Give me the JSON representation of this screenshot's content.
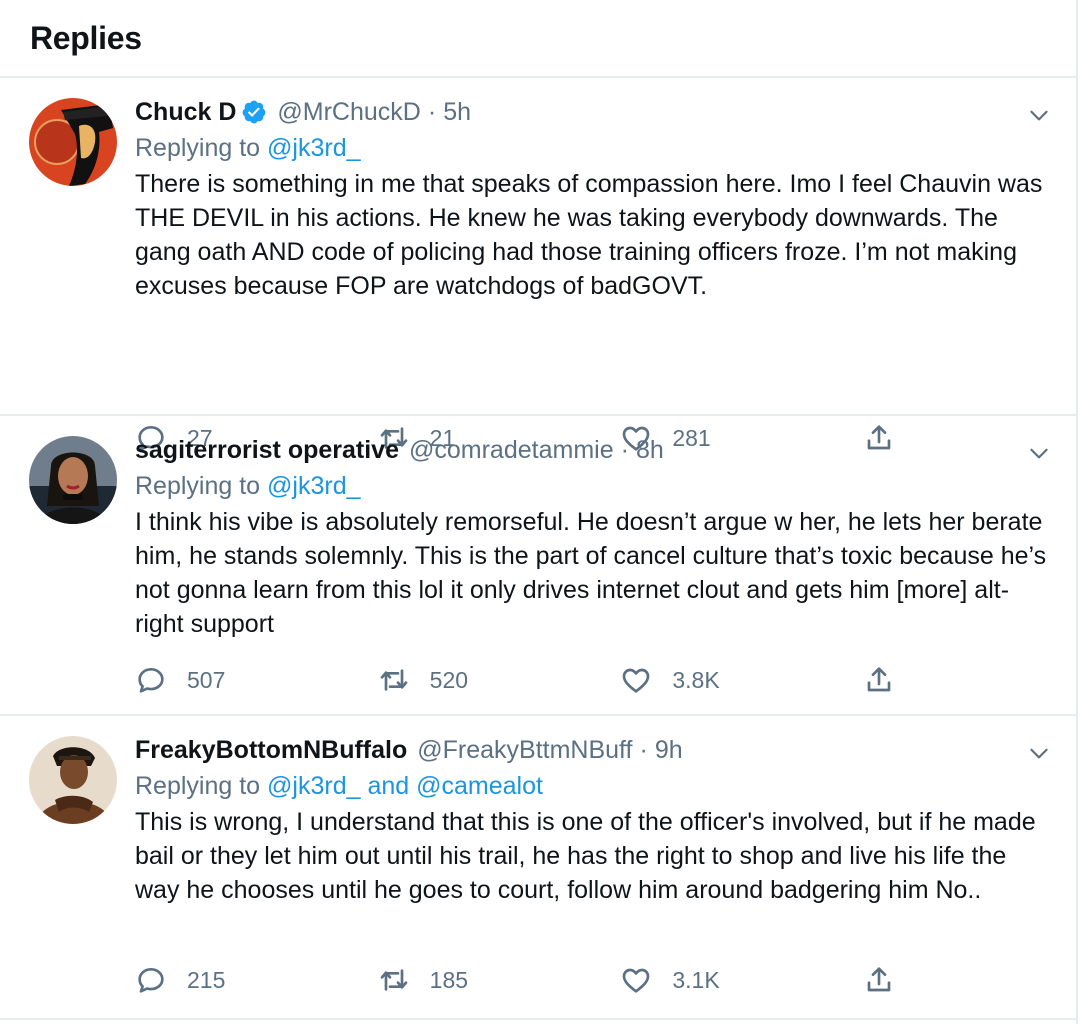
{
  "header": {
    "title": "Replies"
  },
  "replies": [
    {
      "name": "Chuck D",
      "verified": true,
      "handle": "@MrChuckD",
      "time": "5h",
      "replying_label": "Replying to",
      "mentions": "@jk3rd_",
      "text": "There is something in me that speaks of compassion here. Imo I feel Chauvin was THE DEVIL in his actions. He knew he was taking everybody downwards. The gang oath AND code of policing had those training officers froze. I’m not making excuses because FOP are watchdogs of badGOVT.",
      "replies_count": "27",
      "retweets_count": "21",
      "likes_count": "281"
    },
    {
      "name": "sagiterrorist operative",
      "verified": false,
      "handle": "@comradetammie",
      "time": "8h",
      "replying_label": "Replying to",
      "mentions": "@jk3rd_",
      "text": "I think his vibe is absolutely remorseful. He doesn’t argue w her, he lets her berate him, he stands solemnly. This is the part of cancel culture that’s toxic because he’s not gonna learn from this lol it only drives internet clout and gets him [more] alt-right support",
      "replies_count": "507",
      "retweets_count": "520",
      "likes_count": "3.8K"
    },
    {
      "name": "FreakyBottomNBuffalo",
      "verified": false,
      "handle": "@FreakyBttmNBuff",
      "time": "9h",
      "replying_label": "Replying to",
      "mentions": "@jk3rd_ and @camealot",
      "text": "This is wrong, I understand that this is one of the officer's involved, but if he made bail or they let him out until his trail, he has the right to shop and live his life the way he chooses until he goes to court, follow him around badgering him No..",
      "replies_count": "215",
      "retweets_count": "185",
      "likes_count": "3.1K"
    }
  ],
  "colors": {
    "link": "#1b95e0",
    "muted": "#5b7083",
    "divider": "#e6ecf0",
    "verified": "#1da1f2"
  }
}
